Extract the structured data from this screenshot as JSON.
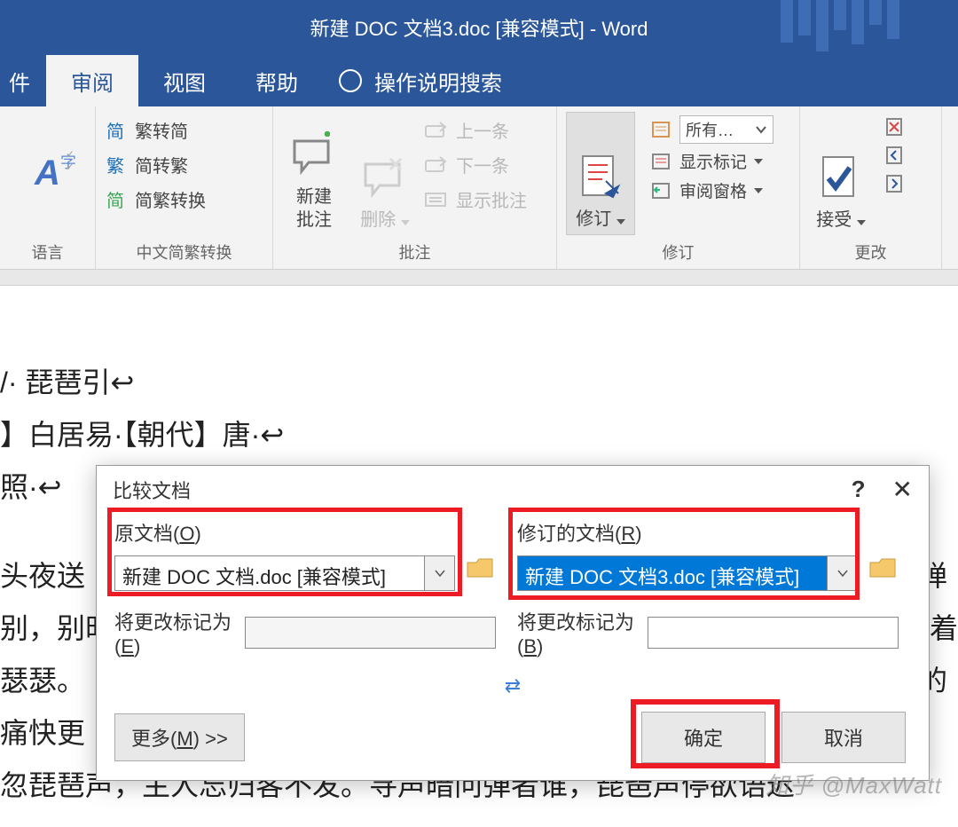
{
  "title": "新建 DOC 文档3.doc [兼容模式]  -  Word",
  "tabs": {
    "file": "件",
    "review": "审阅",
    "view": "视图",
    "help": "帮助",
    "tellme": "操作说明搜索"
  },
  "ribbon": {
    "language": {
      "label": "语言",
      "glyph": "A",
      "sub": "字"
    },
    "simplified": {
      "label": "中文简繁转换",
      "items": [
        {
          "glyph": "简",
          "color": "#1e6fb8",
          "text": "繁转简"
        },
        {
          "glyph": "繁",
          "color": "#1e6fb8",
          "text": "简转繁"
        },
        {
          "glyph": "简",
          "color": "#3aa655",
          "text": "简繁转换"
        }
      ]
    },
    "comments": {
      "label": "批注",
      "new": "新建\n批注",
      "delete": "删除",
      "prev": "上一条",
      "next": "下一条",
      "show": "显示批注"
    },
    "tracking": {
      "label": "修订",
      "track": "修订",
      "all": "所有…",
      "showmarkup": "显示标记",
      "revpane": "审阅窗格"
    },
    "changes": {
      "label": "更改",
      "accept": "接受"
    }
  },
  "doc": {
    "l1": "/· 琵琶引↩",
    "l2": "】白居易·【朝代】唐·↩",
    "l3": "照·↩",
    "l4": "头夜送",
    "l4b": "弹",
    "l5": "别，别时",
    "l5b": "着",
    "l6": "瑟瑟。",
    "l6b": "的",
    "l7": "痛快更",
    "l8": "忽琵琶声，主人忘归客不发。寻声暗问弹者谁，琵琶声停欲语迟"
  },
  "dialog": {
    "title": "比较文档",
    "orig": "原文档(",
    "orig_k": "O",
    "orig_sfx": ")",
    "orig_value": "新建 DOC 文档.doc [兼容模式]",
    "rev": "修订的文档(",
    "rev_k": "R",
    "rev_sfx": ")",
    "rev_value": "新建 DOC 文档3.doc [兼容模式]",
    "mark1": "将更改标记为(",
    "mark1_k": "E",
    "mark1_sfx": ")",
    "mark2": "将更改标记为(",
    "mark2_k": "B",
    "mark2_sfx": ")",
    "more": "更多(",
    "more_k": "M",
    "more_sfx": ") >>",
    "ok": "确定",
    "cancel": "取消"
  },
  "watermark": "知乎 @MaxWatt"
}
